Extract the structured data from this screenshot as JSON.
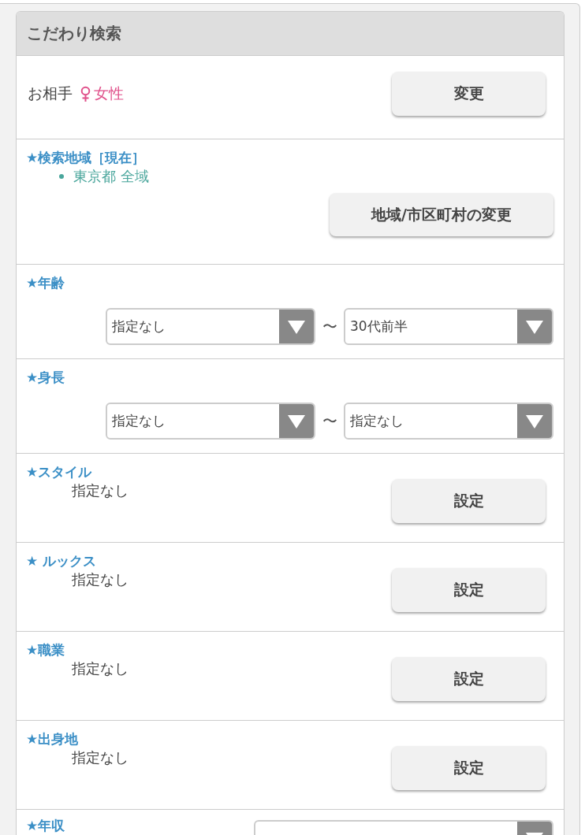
{
  "panel": {
    "title": "こだわり検索"
  },
  "rows": [
    {
      "kind": "partner",
      "label": "お相手",
      "value": "女性",
      "button": "変更"
    },
    {
      "kind": "area",
      "title": "★検索地域［現在］",
      "items": [
        "東京都 全域"
      ],
      "button": "地域/市区町村の変更"
    },
    {
      "kind": "range",
      "title": "★年齢",
      "from": "指定なし",
      "separator": "〜",
      "to": "30代前半"
    },
    {
      "kind": "range",
      "title": "★身長",
      "from": "指定なし",
      "separator": "〜",
      "to": "指定なし"
    },
    {
      "kind": "setting",
      "title": "★スタイル",
      "value": "指定なし",
      "button": "設定"
    },
    {
      "kind": "setting",
      "title": "★ ルックス",
      "value": "指定なし",
      "button": "設定"
    },
    {
      "kind": "setting",
      "title": "★職業",
      "value": "指定なし",
      "button": "設定"
    },
    {
      "kind": "setting",
      "title": "★出身地",
      "value": "指定なし",
      "button": "設定"
    },
    {
      "kind": "single",
      "title": "★年収"
    }
  ]
}
